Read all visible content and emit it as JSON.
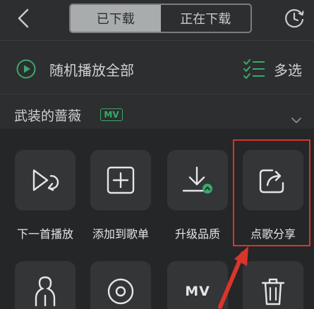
{
  "header": {
    "tabs": [
      {
        "label": "已下载",
        "active": true
      },
      {
        "label": "正在下载",
        "active": false
      }
    ]
  },
  "play_all": {
    "label": "随机播放全部"
  },
  "multi_select": {
    "label": "多选"
  },
  "song": {
    "title": "武装的蔷薇",
    "badge": "MV"
  },
  "actions": {
    "row1": [
      {
        "label": "下一首播放",
        "icon": "play-next-icon"
      },
      {
        "label": "添加到歌单",
        "icon": "add-to-playlist-icon"
      },
      {
        "label": "升级品质",
        "icon": "upgrade-quality-icon"
      },
      {
        "label": "点歌分享",
        "icon": "share-icon"
      }
    ],
    "row2": [
      {
        "icon": "singer-icon"
      },
      {
        "icon": "album-icon"
      },
      {
        "label": "MV",
        "icon": "mv-icon"
      },
      {
        "icon": "delete-icon"
      }
    ]
  },
  "colors": {
    "accent_green": "#3aa96a",
    "highlight_red": "#d9352b"
  }
}
